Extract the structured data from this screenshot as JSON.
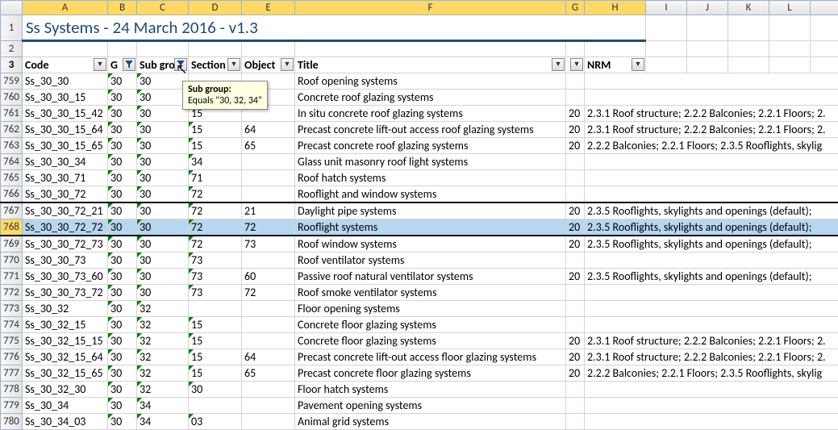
{
  "title": "Ss Systems - 24 March 2016 - v1.3",
  "columns": [
    "",
    "A",
    "B",
    "C",
    "D",
    "E",
    "F",
    "G",
    "H",
    "I",
    "J",
    "K",
    "L"
  ],
  "header": {
    "rownum": "3",
    "code": "Code",
    "g": "G",
    "subgroup": "Sub group",
    "section": "Section",
    "object": "Object",
    "title_h": "Title",
    "nrm": "NRM"
  },
  "tooltip": {
    "title": "Sub group:",
    "body": "Equals \"30, 32, 34\""
  },
  "rows": [
    {
      "n": "759",
      "code": "Ss_30_30",
      "g": "30",
      "sg": "30",
      "sec": "",
      "obj": "",
      "title": "Roof opening systems",
      "gcol": "",
      "nrm": ""
    },
    {
      "n": "760",
      "code": "Ss_30_30_15",
      "g": "30",
      "sg": "30",
      "sec": "",
      "obj": "",
      "title": "Concrete roof glazing systems",
      "gcol": "",
      "nrm": ""
    },
    {
      "n": "761",
      "code": "Ss_30_30_15_42",
      "g": "30",
      "sg": "30",
      "sec": "15",
      "obj": "",
      "title": "In situ concrete roof glazing systems",
      "gcol": "20",
      "nrm": "2.3.1 Roof structure; 2.2.2 Balconies; 2.2.1 Floors; 2."
    },
    {
      "n": "762",
      "code": "Ss_30_30_15_64",
      "g": "30",
      "sg": "30",
      "sec": "15",
      "obj": "64",
      "title": "Precast concrete lift-out access roof glazing systems",
      "gcol": "20",
      "nrm": "2.3.1 Roof structure; 2.2.2 Balconies; 2.2.1 Floors; 2."
    },
    {
      "n": "763",
      "code": "Ss_30_30_15_65",
      "g": "30",
      "sg": "30",
      "sec": "15",
      "obj": "65",
      "title": "Precast concrete roof glazing systems",
      "gcol": "20",
      "nrm": "2.2.2 Balconies; 2.2.1 Floors; 2.3.5 Rooflights, skylig"
    },
    {
      "n": "764",
      "code": "Ss_30_30_34",
      "g": "30",
      "sg": "30",
      "sec": "34",
      "obj": "",
      "title": "Glass unit masonry roof light systems",
      "gcol": "",
      "nrm": ""
    },
    {
      "n": "765",
      "code": "Ss_30_30_71",
      "g": "30",
      "sg": "30",
      "sec": "71",
      "obj": "",
      "title": "Roof hatch systems",
      "gcol": "",
      "nrm": ""
    },
    {
      "n": "766",
      "code": "Ss_30_30_72",
      "g": "30",
      "sg": "30",
      "sec": "72",
      "obj": "",
      "title": "Rooflight and window systems",
      "gcol": "",
      "nrm": ""
    },
    {
      "n": "767",
      "code": "Ss_30_30_72_21",
      "g": "30",
      "sg": "30",
      "sec": "72",
      "obj": "21",
      "title": "Daylight pipe systems",
      "gcol": "20",
      "nrm": "2.3.5 Rooflights, skylights and openings (default);"
    },
    {
      "n": "768",
      "code": "Ss_30_30_72_72",
      "g": "30",
      "sg": "30",
      "sec": "72",
      "obj": "72",
      "title": "Rooflight systems",
      "gcol": "20",
      "nrm": "2.3.5 Rooflights, skylights and openings (default);"
    },
    {
      "n": "769",
      "code": "Ss_30_30_72_73",
      "g": "30",
      "sg": "30",
      "sec": "72",
      "obj": "73",
      "title": "Roof window systems",
      "gcol": "20",
      "nrm": "2.3.5 Rooflights, skylights and openings (default);"
    },
    {
      "n": "770",
      "code": "Ss_30_30_73",
      "g": "30",
      "sg": "30",
      "sec": "73",
      "obj": "",
      "title": "Roof ventilator systems",
      "gcol": "",
      "nrm": ""
    },
    {
      "n": "771",
      "code": "Ss_30_30_73_60",
      "g": "30",
      "sg": "30",
      "sec": "73",
      "obj": "60",
      "title": "Passive roof natural ventilator systems",
      "gcol": "20",
      "nrm": "2.3.5 Rooflights, skylights and openings (default);"
    },
    {
      "n": "772",
      "code": "Ss_30_30_73_72",
      "g": "30",
      "sg": "30",
      "sec": "73",
      "obj": "72",
      "title": "Roof smoke ventilator systems",
      "gcol": "",
      "nrm": ""
    },
    {
      "n": "773",
      "code": "Ss_30_32",
      "g": "30",
      "sg": "32",
      "sec": "",
      "obj": "",
      "title": "Floor opening systems",
      "gcol": "",
      "nrm": ""
    },
    {
      "n": "774",
      "code": "Ss_30_32_15",
      "g": "30",
      "sg": "32",
      "sec": "15",
      "obj": "",
      "title": "Concrete floor glazing systems",
      "gcol": "",
      "nrm": ""
    },
    {
      "n": "775",
      "code": "Ss_30_32_15_15",
      "g": "30",
      "sg": "32",
      "sec": "15",
      "obj": "",
      "title": "Concrete floor glazing systems",
      "gcol": "20",
      "nrm": "2.3.1 Roof structure; 2.2.2 Balconies; 2.2.1 Floors; 2."
    },
    {
      "n": "776",
      "code": "Ss_30_32_15_64",
      "g": "30",
      "sg": "32",
      "sec": "15",
      "obj": "64",
      "title": "Precast concrete lift-out access floor glazing systems",
      "gcol": "20",
      "nrm": "2.3.1 Roof structure; 2.2.2 Balconies; 2.2.1 Floors; 2."
    },
    {
      "n": "777",
      "code": "Ss_30_32_15_65",
      "g": "30",
      "sg": "32",
      "sec": "15",
      "obj": "65",
      "title": "Precast concrete floor glazing systems",
      "gcol": "20",
      "nrm": "2.2.2 Balconies; 2.2.1 Floors; 2.3.5 Rooflights, skylig"
    },
    {
      "n": "778",
      "code": "Ss_30_32_30",
      "g": "30",
      "sg": "32",
      "sec": "30",
      "obj": "",
      "title": "Floor hatch systems",
      "gcol": "",
      "nrm": ""
    },
    {
      "n": "779",
      "code": "Ss_30_34",
      "g": "30",
      "sg": "34",
      "sec": "",
      "obj": "",
      "title": "Pavement opening systems",
      "gcol": "",
      "nrm": ""
    },
    {
      "n": "780",
      "code": "Ss_30_34_03",
      "g": "30",
      "sg": "34",
      "sec": "03",
      "obj": "",
      "title": "Animal grid systems",
      "gcol": "",
      "nrm": ""
    }
  ]
}
